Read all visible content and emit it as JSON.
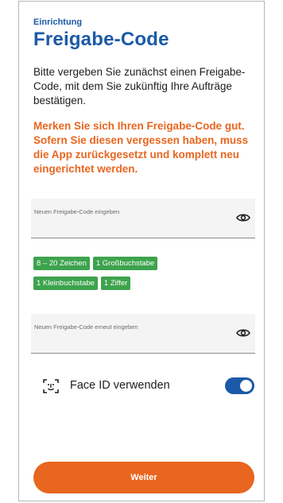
{
  "header": {
    "kicker": "Einrichtung",
    "title": "Freigabe-Code"
  },
  "intro": "Bitte vergeben Sie zunächst einen Freigabe-Code, mit dem Sie zukünftig Ihre Aufträge bestätigen.",
  "warning": "Merken Sie sich Ihren Freigabe-Code gut. Sofern Sie diesen vergessen haben, muss die App zurückgesetzt und komplett neu eingerichtet werden.",
  "fields": {
    "new_code": {
      "placeholder": "Neuen Freigabe-Code eingeben",
      "value": "",
      "icon": "eye-icon"
    },
    "repeat_code": {
      "placeholder": "Neuen Freigabe-Code erneut eingeben",
      "value": "",
      "icon": "eye-icon"
    }
  },
  "requirements": [
    "8 – 20 Zeichen",
    "1 Großbuchstabe",
    "1 Kleinbuchstabe",
    "1 Ziffer"
  ],
  "face_id": {
    "label": "Face ID verwenden",
    "icon": "face-id-icon",
    "enabled": true
  },
  "cta": {
    "label": "Weiter"
  },
  "colors": {
    "primary": "#1a5aa8",
    "accent": "#e8661f",
    "success": "#3da34d"
  }
}
